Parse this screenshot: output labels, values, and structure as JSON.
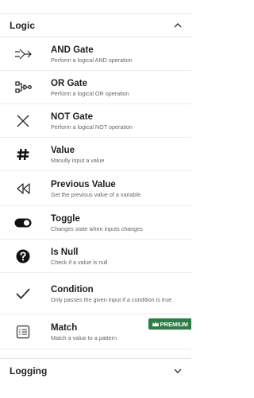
{
  "sections": {
    "logic": {
      "title": "Logic",
      "expanded": true
    },
    "logging": {
      "title": "Logging",
      "expanded": false
    }
  },
  "items": [
    {
      "name": "AND Gate",
      "desc": "Perform a logical AND operation",
      "icon": "and-gate-icon"
    },
    {
      "name": "OR Gate",
      "desc": "Perform a logical OR operation",
      "icon": "or-gate-icon"
    },
    {
      "name": "NOT Gate",
      "desc": "Perform a logical NOT operation",
      "icon": "not-gate-icon"
    },
    {
      "name": "Value",
      "desc": "Manully input a value",
      "icon": "hash-icon"
    },
    {
      "name": "Previous Value",
      "desc": "Get the previous value of a variable",
      "icon": "rewind-icon"
    },
    {
      "name": "Toggle",
      "desc": "Changes state when inputs changes",
      "icon": "toggle-icon"
    },
    {
      "name": "Is Null",
      "desc": "Check if a value is null",
      "icon": "question-icon"
    },
    {
      "name": "Condition",
      "desc": "Only passes the given input if a condition is true",
      "icon": "check-icon"
    },
    {
      "name": "Match",
      "desc": "Match a value to a pattern",
      "icon": "list-icon",
      "badge": "PREMIUM"
    }
  ],
  "colors": {
    "premium_badge": "#2e7d46"
  }
}
